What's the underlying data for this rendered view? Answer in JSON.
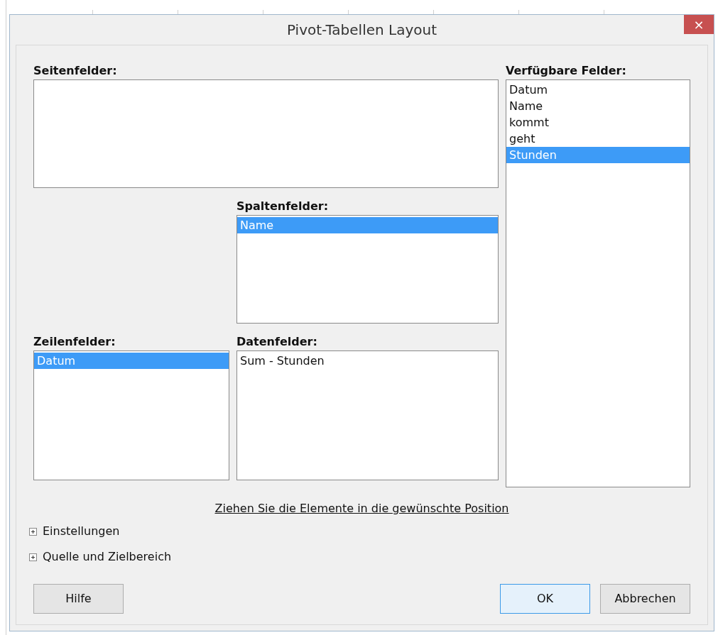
{
  "window": {
    "title": "Pivot-Tabellen Layout",
    "close": "×"
  },
  "page_fields": {
    "label": "Seitenfelder:"
  },
  "available_fields": {
    "label": "Verfügbare Felder:",
    "items": [
      {
        "text": "Datum",
        "selected": false
      },
      {
        "text": "Name",
        "selected": false
      },
      {
        "text": "kommt",
        "selected": false
      },
      {
        "text": "geht",
        "selected": false
      },
      {
        "text": "Stunden",
        "selected": true
      }
    ]
  },
  "column_fields": {
    "label": "Spaltenfelder:",
    "items": [
      {
        "text": "Name",
        "selected": true
      }
    ]
  },
  "row_fields": {
    "label": "Zeilenfelder:",
    "items": [
      {
        "text": "Datum",
        "selected": true
      }
    ]
  },
  "data_fields": {
    "label": "Datenfelder:",
    "items": [
      {
        "text": "Sum - Stunden",
        "selected": false
      }
    ]
  },
  "hint": "Ziehen Sie die Elemente in die gewünschte Position",
  "sections": [
    {
      "label": "Einstellungen",
      "expanded": false
    },
    {
      "label": "Quelle und Zielbereich",
      "expanded": false
    }
  ],
  "buttons": [
    {
      "label": "Hilfe",
      "kind": "help"
    },
    {
      "label": "OK",
      "kind": "default"
    },
    {
      "label": "Abbrechen",
      "kind": "cancel"
    }
  ]
}
